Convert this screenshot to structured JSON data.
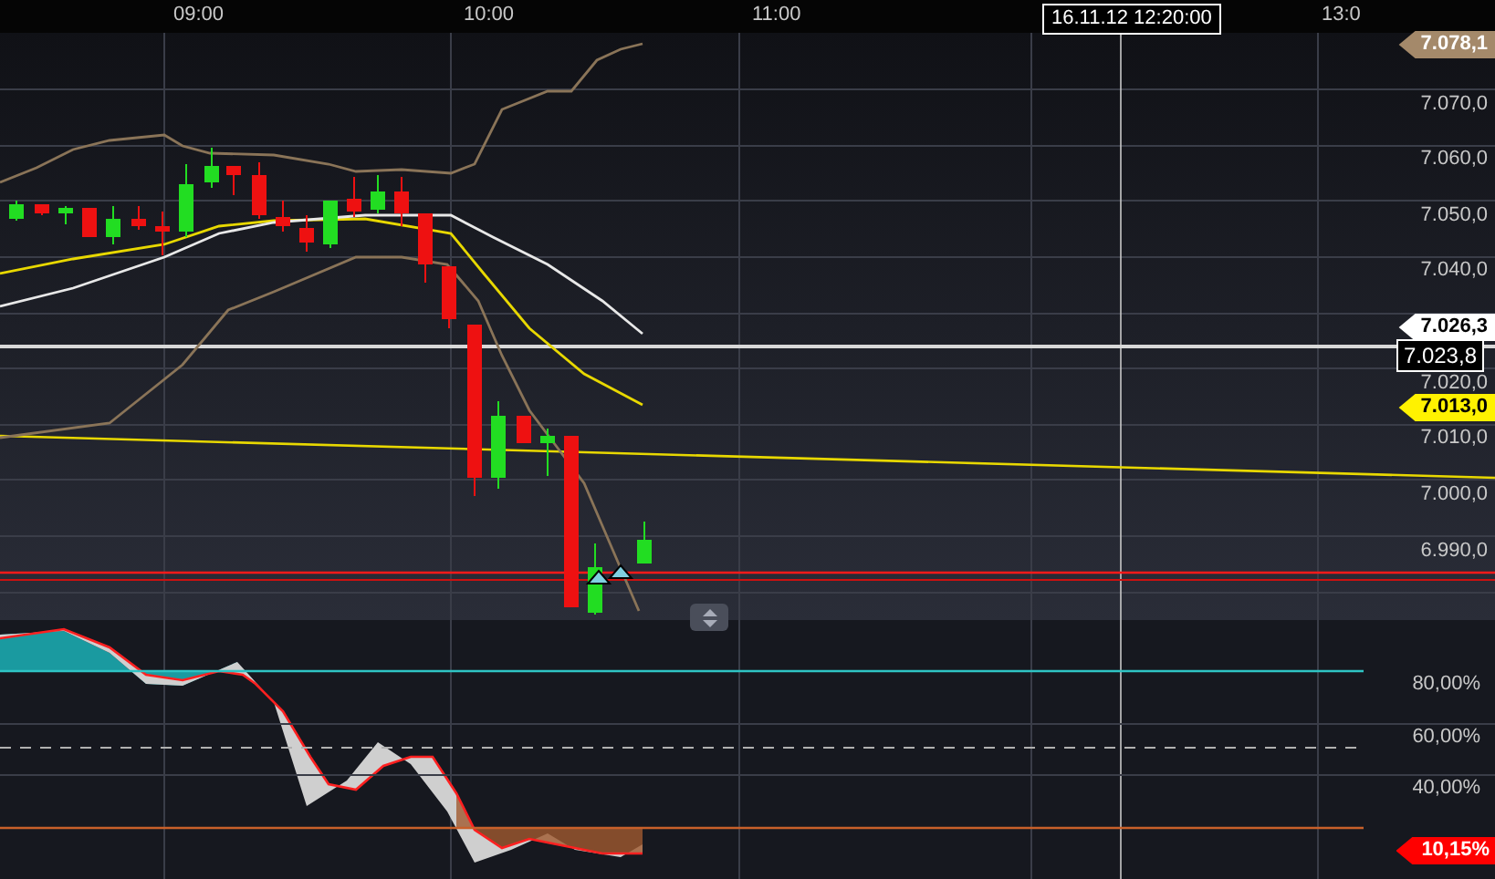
{
  "time_axis": {
    "labels": [
      "09:00",
      "10:00",
      "11:00",
      "13:0"
    ]
  },
  "crosshair": {
    "time": "16.11.12 12:20:00",
    "price": "7.023,8"
  },
  "price_axis": {
    "labels": [
      "7.070,0",
      "7.060,0",
      "7.050,0",
      "7.040,0",
      "7.020,0",
      "7.010,0",
      "7.000,0",
      "6.990,0"
    ]
  },
  "price_markers": [
    {
      "kind": "band",
      "label": "7.078,1",
      "color": "#a4896a"
    },
    {
      "kind": "last",
      "label": "7.026,3",
      "color": "#ffffff"
    },
    {
      "kind": "average",
      "label": "7.013,0",
      "color": "#fff200"
    }
  ],
  "indicator": {
    "axis_labels": [
      "80,00%",
      "60,00%",
      "40,00%"
    ],
    "marker": {
      "label": "10,15%",
      "color": "#ff0000"
    }
  }
}
